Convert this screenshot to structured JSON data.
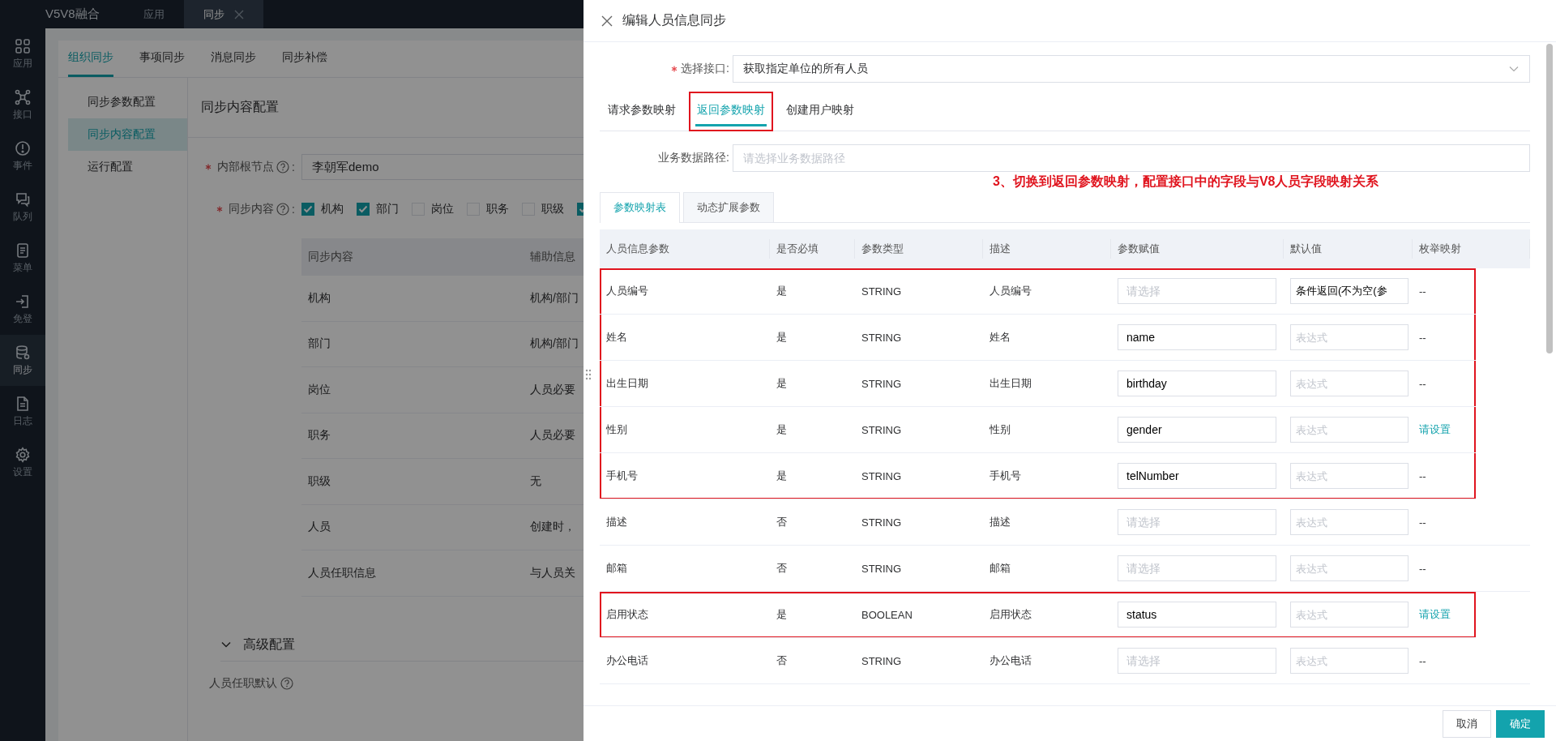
{
  "topbar": {
    "app_title": "V5V8融合",
    "tabs": [
      {
        "label": "应用",
        "selected": false,
        "closable": false
      },
      {
        "label": "同步",
        "selected": true,
        "closable": true
      }
    ]
  },
  "sidebar": {
    "items": [
      {
        "label": "应用",
        "selected": false
      },
      {
        "label": "接口",
        "selected": false
      },
      {
        "label": "事件",
        "selected": false
      },
      {
        "label": "队列",
        "selected": false
      },
      {
        "label": "菜单",
        "selected": false
      },
      {
        "label": "免登",
        "selected": false
      },
      {
        "label": "同步",
        "selected": true
      },
      {
        "label": "日志",
        "selected": false
      },
      {
        "label": "设置",
        "selected": false
      }
    ]
  },
  "main": {
    "tabs": [
      {
        "label": "组织同步",
        "selected": true
      },
      {
        "label": "事项同步",
        "selected": false
      },
      {
        "label": "消息同步",
        "selected": false
      },
      {
        "label": "同步补偿",
        "selected": false
      }
    ],
    "menu": [
      {
        "label": "同步参数配置",
        "selected": false
      },
      {
        "label": "同步内容配置",
        "selected": true
      },
      {
        "label": "运行配置",
        "selected": false
      }
    ],
    "section_title": "同步内容配置",
    "root_node": {
      "label": "内部根节点",
      "colon": ":",
      "required": true,
      "value": "李朝军demo"
    },
    "sync_content": {
      "label": "同步内容",
      "colon": ":",
      "required": true,
      "options": [
        {
          "label": "机构",
          "checked": true
        },
        {
          "label": "部门",
          "checked": true
        },
        {
          "label": "岗位",
          "checked": false
        },
        {
          "label": "职务",
          "checked": false
        },
        {
          "label": "职级",
          "checked": false
        },
        {
          "checked": true
        }
      ]
    },
    "table": {
      "columns": [
        "同步内容",
        "辅助信息"
      ],
      "rows": [
        [
          "机构",
          "机构/部门"
        ],
        [
          "部门",
          "机构/部门"
        ],
        [
          "岗位",
          "人员必要"
        ],
        [
          "职务",
          "人员必要"
        ],
        [
          "职级",
          "无"
        ],
        [
          "人员",
          "创建时，"
        ],
        [
          "人员任职信息",
          "与人员关"
        ]
      ]
    },
    "advanced": {
      "title": "高级配置",
      "expanded": true,
      "field_label": "人员任职默认"
    }
  },
  "drawer": {
    "title": "编辑人员信息同步",
    "interface": {
      "label": "选择接口:",
      "required": true,
      "value": "获取指定单位的所有人员"
    },
    "tabs": [
      {
        "label": "请求参数映射",
        "selected": false,
        "boxed": false
      },
      {
        "label": "返回参数映射",
        "selected": true,
        "boxed": true
      },
      {
        "label": "创建用户映射",
        "selected": false,
        "boxed": false
      }
    ],
    "data_path": {
      "label": "业务数据路径:",
      "placeholder": "请选择业务数据路径"
    },
    "note": "3、切换到返回参数映射，配置接口中的字段与V8人员字段映射关系",
    "subtabs": [
      {
        "label": "参数映射表",
        "selected": true
      },
      {
        "label": "动态扩展参数",
        "selected": false
      }
    ],
    "table": {
      "columns": [
        "人员信息参数",
        "是否必填",
        "参数类型",
        "描述",
        "参数赋值",
        "默认值",
        "枚举映射"
      ],
      "rows": [
        {
          "param": "人员编号",
          "required": "是",
          "type": "STRING",
          "desc": "人员编号",
          "assign": {
            "placeholder": "请选择"
          },
          "default": {
            "value": "条件返回(不为空(参"
          },
          "enum": {
            "kind": "text",
            "text": "--"
          },
          "boxed": true
        },
        {
          "param": "姓名",
          "required": "是",
          "type": "STRING",
          "desc": "姓名",
          "assign": {
            "value": "name"
          },
          "default": {
            "placeholder": "表达式"
          },
          "enum": {
            "kind": "text",
            "text": "--"
          },
          "boxed": true
        },
        {
          "param": "出生日期",
          "required": "是",
          "type": "STRING",
          "desc": "出生日期",
          "assign": {
            "value": "birthday"
          },
          "default": {
            "placeholder": "表达式"
          },
          "enum": {
            "kind": "text",
            "text": "--"
          },
          "boxed": true
        },
        {
          "param": "性别",
          "required": "是",
          "type": "STRING",
          "desc": "性别",
          "assign": {
            "value": "gender"
          },
          "default": {
            "placeholder": "表达式"
          },
          "enum": {
            "kind": "link",
            "text": "请设置"
          },
          "boxed": true
        },
        {
          "param": "手机号",
          "required": "是",
          "type": "STRING",
          "desc": "手机号",
          "assign": {
            "value": "telNumber"
          },
          "default": {
            "placeholder": "表达式"
          },
          "enum": {
            "kind": "text",
            "text": "--"
          },
          "boxed": true
        },
        {
          "param": "描述",
          "required": "否",
          "type": "STRING",
          "desc": "描述",
          "assign": {
            "placeholder": "请选择"
          },
          "default": {
            "placeholder": "表达式"
          },
          "enum": {
            "kind": "text",
            "text": "--"
          },
          "boxed": false
        },
        {
          "param": "邮箱",
          "required": "否",
          "type": "STRING",
          "desc": "邮箱",
          "assign": {
            "placeholder": "请选择"
          },
          "default": {
            "placeholder": "表达式"
          },
          "enum": {
            "kind": "text",
            "text": "--"
          },
          "boxed": false
        },
        {
          "param": "启用状态",
          "required": "是",
          "type": "BOOLEAN",
          "desc": "启用状态",
          "assign": {
            "value": "status"
          },
          "default": {
            "placeholder": "表达式"
          },
          "enum": {
            "kind": "link",
            "text": "请设置"
          },
          "boxed": true
        },
        {
          "param": "办公电话",
          "required": "否",
          "type": "STRING",
          "desc": "办公电话",
          "assign": {
            "placeholder": "请选择"
          },
          "default": {
            "placeholder": "表达式"
          },
          "enum": {
            "kind": "text",
            "text": "--"
          },
          "boxed": false
        }
      ]
    },
    "buttons": [
      {
        "label": "取消",
        "kind": "default"
      },
      {
        "label": "确定",
        "kind": "primary"
      }
    ]
  }
}
